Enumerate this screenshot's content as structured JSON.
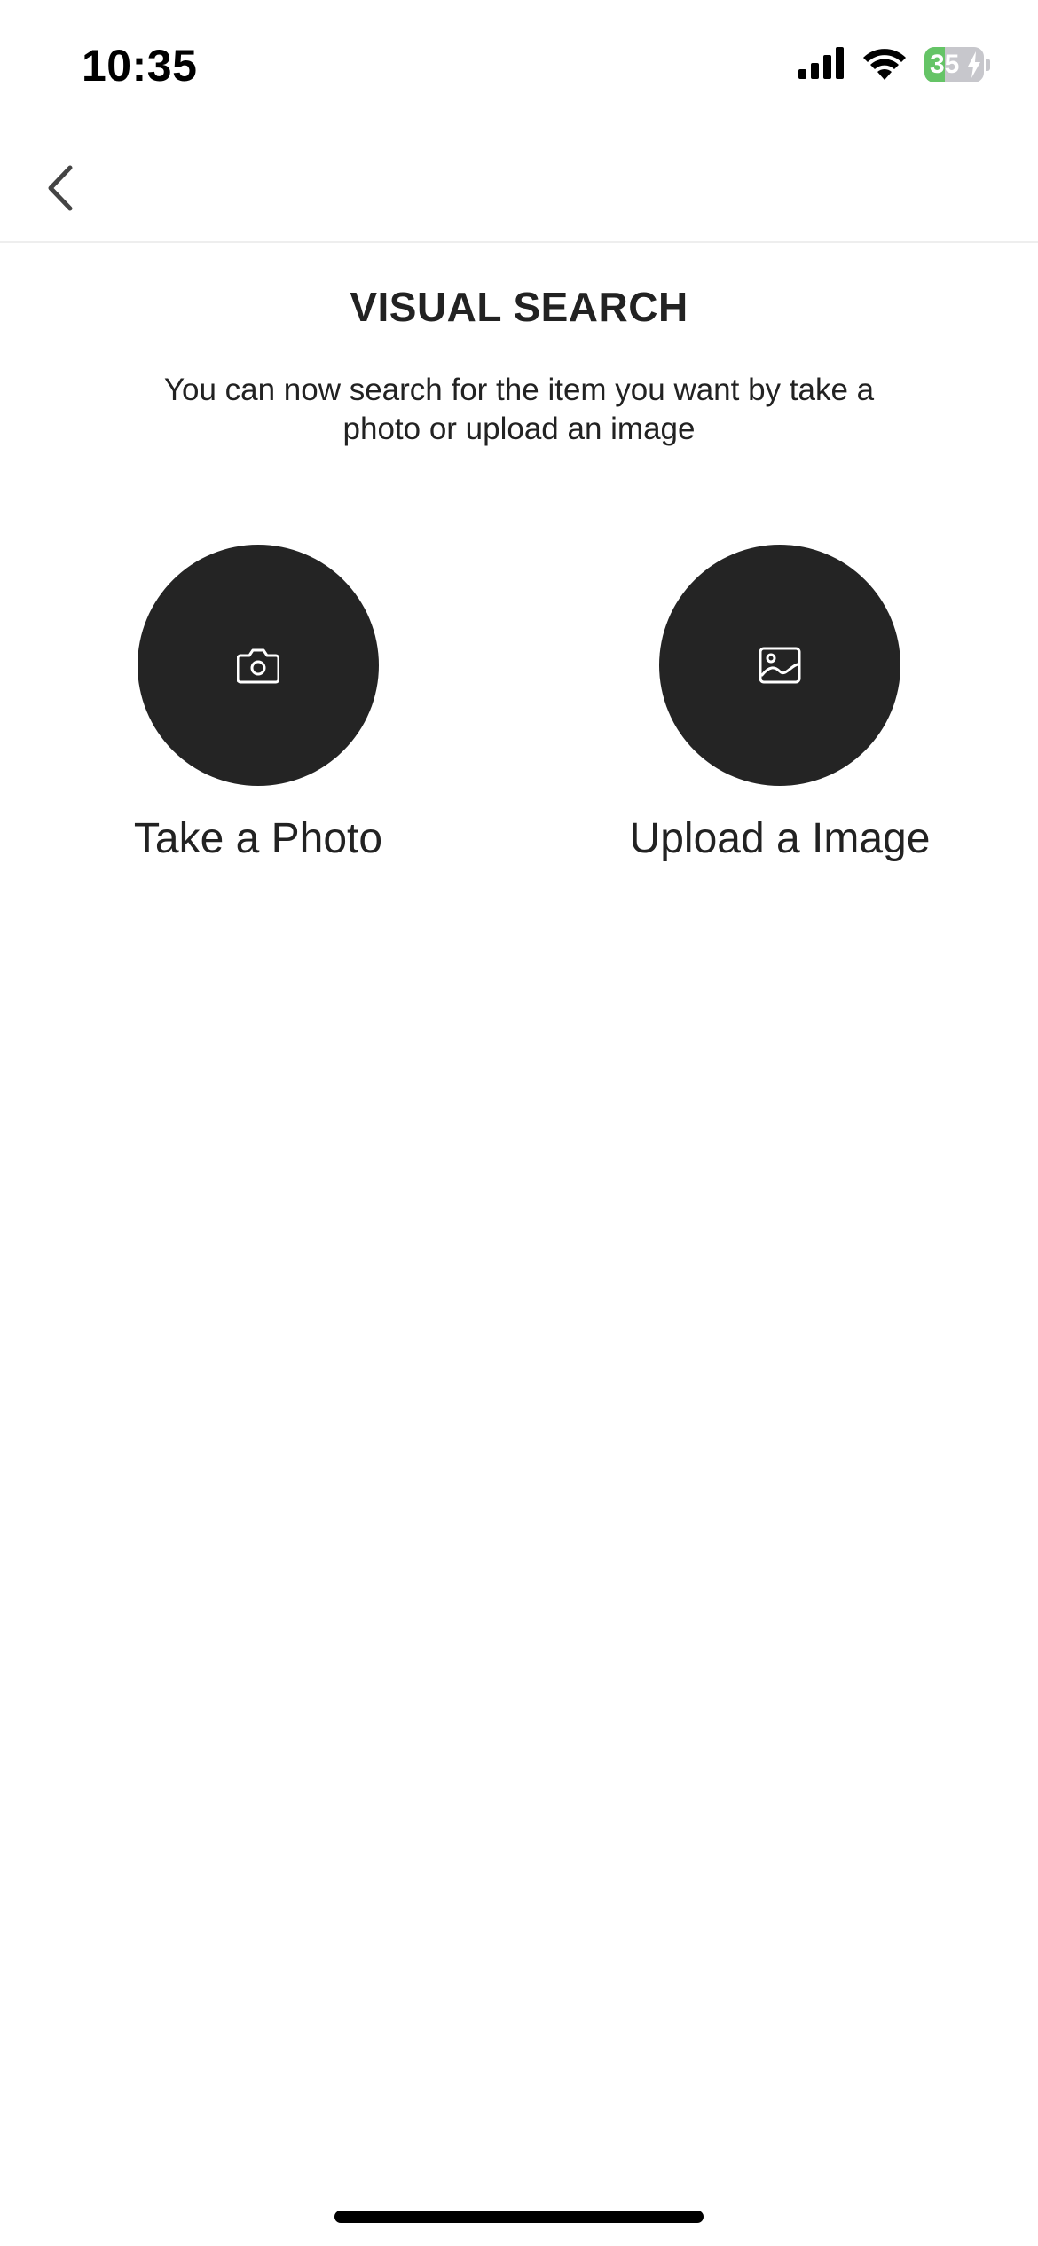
{
  "status_bar": {
    "time": "10:35",
    "battery_level": "35",
    "battery_percent": 35,
    "icons": [
      "cellular-signal-icon",
      "wifi-icon",
      "battery-charging-icon"
    ]
  },
  "nav": {
    "back_icon": "chevron-left-icon"
  },
  "header": {
    "title": "VISUAL SEARCH",
    "subtitle": "You can now search for the item you want by take a photo or upload an image"
  },
  "options": [
    {
      "label": "Take a Photo",
      "icon": "camera-icon"
    },
    {
      "label": "Upload a Image",
      "icon": "image-icon"
    }
  ],
  "colors": {
    "button_background": "#242424",
    "text": "#222222",
    "battery_green": "#65c466",
    "divider": "#eeeeee"
  }
}
